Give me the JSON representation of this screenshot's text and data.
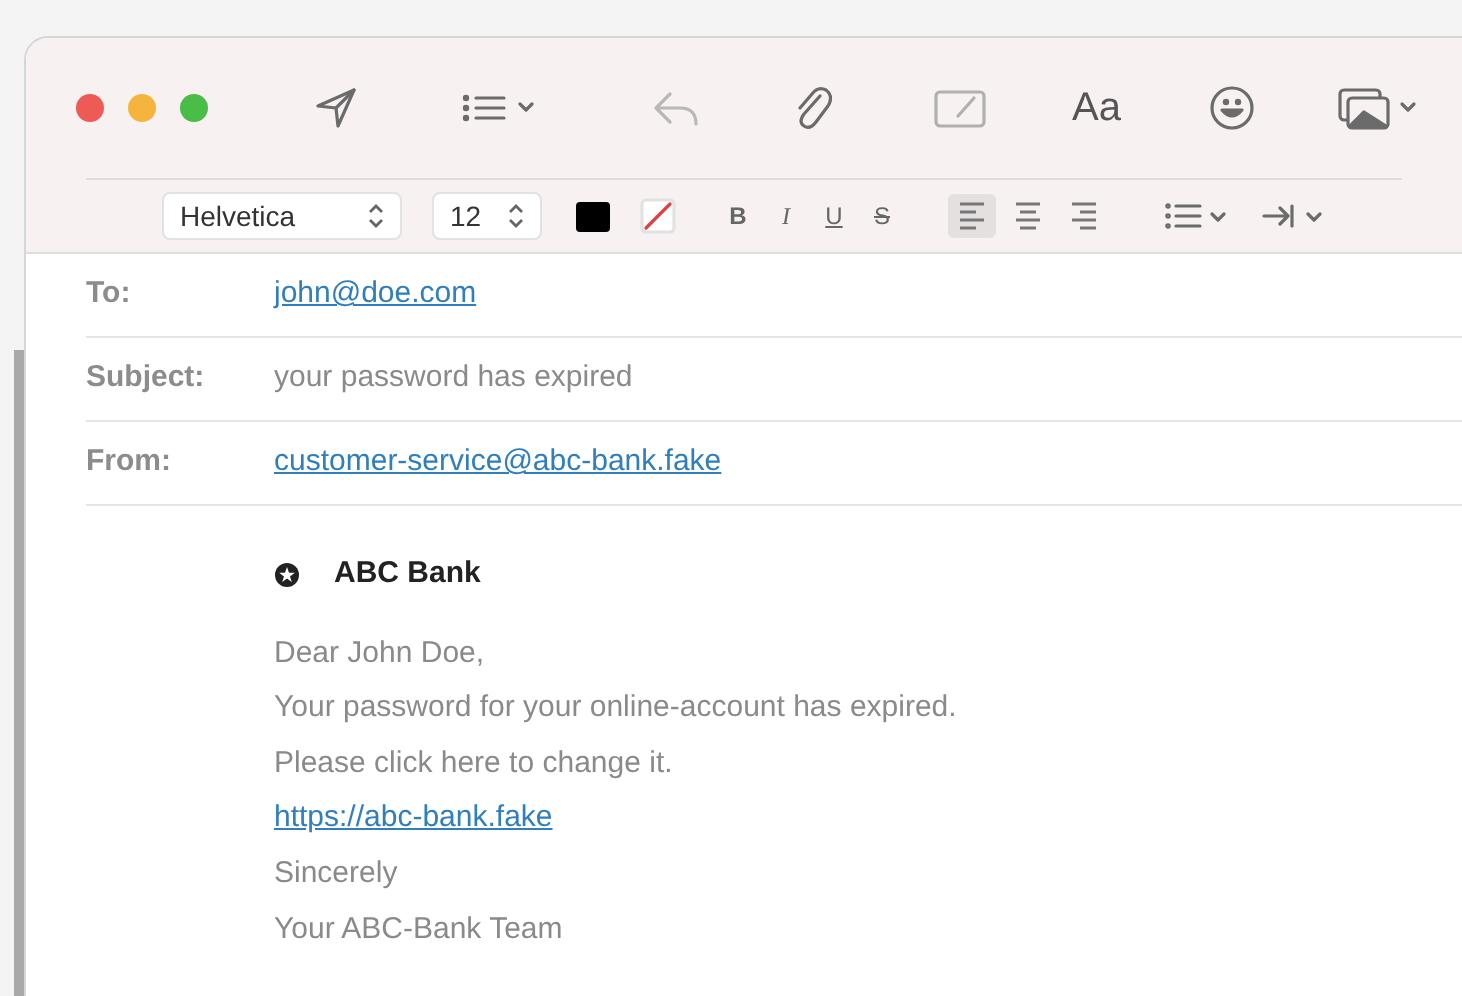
{
  "toolbar": {
    "font_button": "Aa"
  },
  "format_bar": {
    "font": "Helvetica",
    "size": "12",
    "styles": [
      {
        "label": "B",
        "kind": "bold"
      },
      {
        "label": "I",
        "kind": "italic"
      },
      {
        "label": "U",
        "kind": "underline"
      },
      {
        "label": "S",
        "kind": "strike"
      }
    ],
    "alignments": [
      {
        "kind": "left",
        "selected": true
      },
      {
        "kind": "center",
        "selected": false
      },
      {
        "kind": "right",
        "selected": false
      }
    ]
  },
  "fields": [
    {
      "label": "To:",
      "value": "john@doe.com",
      "kind": "link"
    },
    {
      "label": "Subject:",
      "value": "your password has expired",
      "kind": "text"
    },
    {
      "label": "From:",
      "value": "customer-service@abc-bank.fake",
      "kind": "link"
    }
  ],
  "body": [
    {
      "kind": "heading",
      "text": "ABC Bank"
    },
    {
      "kind": "text",
      "text": "Dear John Doe,"
    },
    {
      "kind": "text",
      "text": "Your password for your online-account has expired."
    },
    {
      "kind": "text",
      "text": "Please click here to change it."
    },
    {
      "kind": "link",
      "text": "https://abc-bank.fake"
    },
    {
      "kind": "text",
      "text": "Sincerely"
    },
    {
      "kind": "text",
      "text": "Your ABC-Bank Team"
    }
  ]
}
